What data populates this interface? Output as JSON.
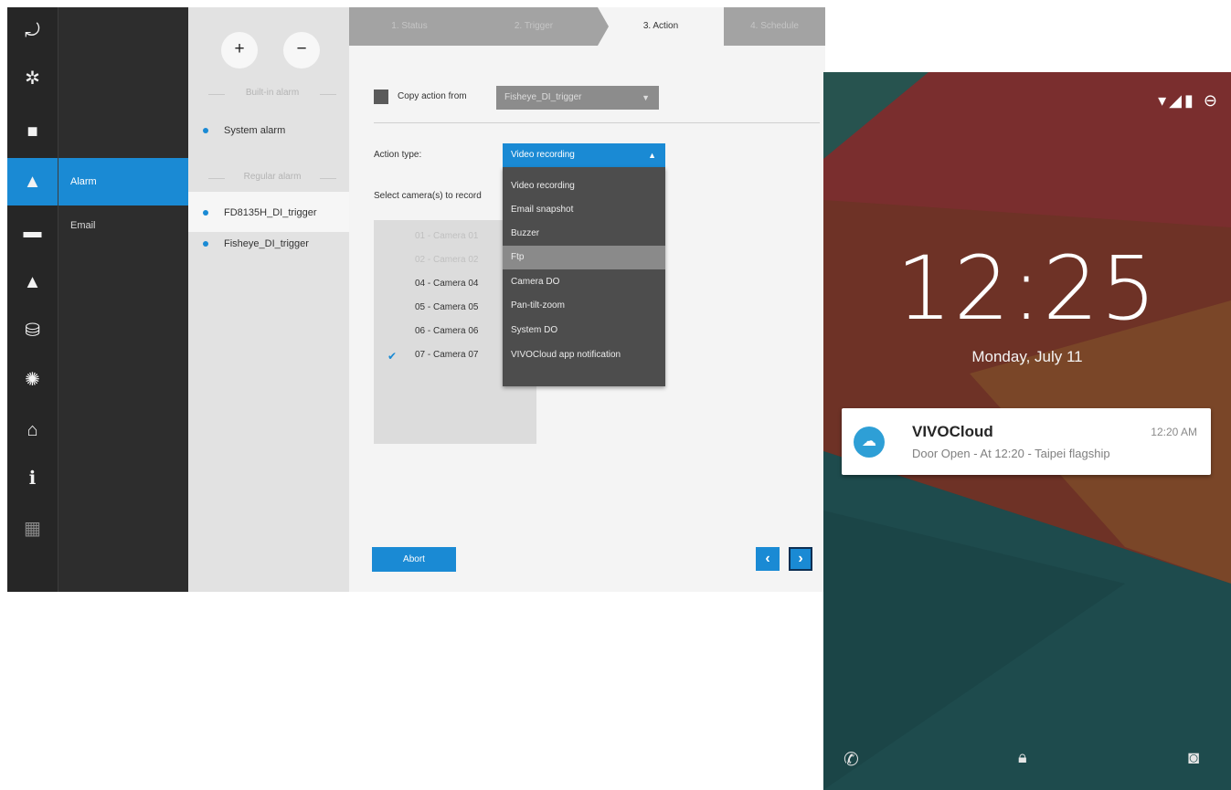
{
  "nvr": {
    "nav_icons": [
      {
        "name": "playback-icon",
        "glyph": "⤾"
      },
      {
        "name": "gear-icon",
        "glyph": "✲"
      },
      {
        "name": "video-camera-icon",
        "glyph": "■"
      },
      {
        "name": "bell-icon",
        "glyph": "▲"
      },
      {
        "name": "monitor-icon",
        "glyph": "▬"
      },
      {
        "name": "user-icon",
        "glyph": "▲"
      },
      {
        "name": "database-icon",
        "glyph": "⛁"
      },
      {
        "name": "network-globe-icon",
        "glyph": "✺"
      },
      {
        "name": "bank-icon",
        "glyph": "⌂"
      },
      {
        "name": "info-icon",
        "glyph": "ℹ"
      },
      {
        "name": "keyboard-icon",
        "glyph": "▦"
      }
    ],
    "submenu": {
      "alarm": "Alarm",
      "email": "Email"
    },
    "alarm_list": {
      "add": "+",
      "remove": "−",
      "builtin_header": "Built-in alarm",
      "builtin_items": [
        "System alarm"
      ],
      "regular_header": "Regular alarm",
      "regular_items": [
        "FD8135H_DI_trigger",
        "Fisheye_DI_trigger"
      ]
    },
    "steps": [
      "1. Status",
      "2. Trigger",
      "3. Action",
      "4. Schedule"
    ],
    "copy_label": "Copy action from",
    "copy_value": "Fisheye_DI_trigger",
    "action_type_label": "Action type:",
    "action_type_value": "Video recording",
    "select_cameras_label": "Select camera(s) to record",
    "cameras": [
      "01 - Camera 01",
      "02 - Camera 02",
      "04 - Camera 04",
      "05 - Camera 05",
      "06 - Camera 06",
      "07 - Camera 07"
    ],
    "check_mark": "✔",
    "action_options": [
      "Video recording",
      "Email snapshot",
      "Buzzer",
      "Ftp",
      "Camera DO",
      "Pan-tilt-zoom",
      "System DO",
      "VIVOCloud app notification"
    ],
    "abort": "Abort",
    "prev": "‹",
    "next": "›",
    "accent_color": "#1a8ad4"
  },
  "phone": {
    "status_icons": "▾◢▮ ⊖",
    "time": "12:25",
    "date": "Monday, July 11",
    "notification": {
      "app": "VIVOCloud",
      "time": "12:20 AM",
      "text": "Door Open - At 12:20 - Taipei flagship",
      "icon": "cloud-icon"
    },
    "bottom_icons": {
      "phone": "✆",
      "lock": "🔒︎",
      "camera": "◙"
    }
  }
}
